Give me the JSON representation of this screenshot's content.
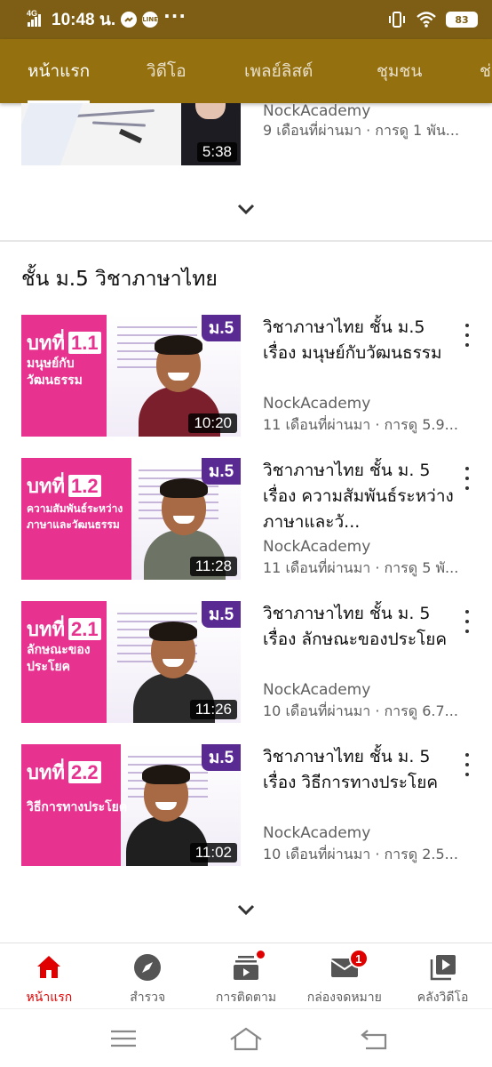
{
  "status_bar": {
    "network": "4G",
    "time": "10:48 น.",
    "battery": "83",
    "icons": [
      "signal-icon",
      "messenger-icon",
      "line-icon",
      "more-dots-icon",
      "vibrate-icon",
      "wifi-icon",
      "battery-icon"
    ]
  },
  "tabs": [
    {
      "label": "หน้าแรก",
      "active": true
    },
    {
      "label": "วิดีโอ",
      "active": false
    },
    {
      "label": "เพลย์ลิสต์",
      "active": false
    },
    {
      "label": "ชุมชน",
      "active": false
    },
    {
      "label": "ช่",
      "active": false
    }
  ],
  "top_video": {
    "channel": "NockAcademy",
    "stats": "9 เดือนที่ผ่านมา · การดู 1 พัน...",
    "duration": "5:38"
  },
  "section": {
    "title": "ชั้น ม.5 วิชาภาษาไทย",
    "videos": [
      {
        "title": "วิชาภาษาไทย ชั้น ม.5 เรื่อง มนุษย์กับวัฒนธรรม",
        "channel": "NockAcademy",
        "stats": "11 เดือนที่ผ่านมา · การดู 5.9...",
        "duration": "10:20",
        "thumb_chapter": "บทที่",
        "thumb_number": "1.1",
        "thumb_subtitle": "มนุษย์กับ วัฒนธรรม",
        "thumb_grade": "ม.5",
        "shirt_color": "#7a1f2b"
      },
      {
        "title": "วิชาภาษาไทย ชั้น ม. 5 เรื่อง ความสัมพันธ์ระหว่างภาษาและวั...",
        "channel": "NockAcademy",
        "stats": "11 เดือนที่ผ่านมา · การดู 5 พั...",
        "duration": "11:28",
        "thumb_chapter": "บทที่",
        "thumb_number": "1.2",
        "thumb_subtitle": "ความสัมพันธ์ระหว่าง ภาษาและวัฒนธรรม",
        "thumb_grade": "ม.5",
        "shirt_color": "#6d7466"
      },
      {
        "title": "วิชาภาษาไทย ชั้น ม. 5 เรื่อง ลักษณะของประโยค",
        "channel": "NockAcademy",
        "stats": "10 เดือนที่ผ่านมา · การดู 6.7...",
        "duration": "11:26",
        "thumb_chapter": "บทที่",
        "thumb_number": "2.1",
        "thumb_subtitle": "ลักษณะของ ประโยค",
        "thumb_grade": "ม.5",
        "shirt_color": "#2b2b2b"
      },
      {
        "title": "วิชาภาษาไทย ชั้น ม. 5 เรื่อง วิธีการทางประโยค",
        "channel": "NockAcademy",
        "stats": "10 เดือนที่ผ่านมา · การดู 2.5...",
        "duration": "11:02",
        "thumb_chapter": "บทที่",
        "thumb_number": "2.2",
        "thumb_subtitle": "วิธีการทางประโยค",
        "thumb_grade": "ม.5",
        "shirt_color": "#1f1f1f"
      }
    ]
  },
  "bottom_nav": [
    {
      "label": "หน้าแรก",
      "icon": "home-icon",
      "active": true
    },
    {
      "label": "สำรวจ",
      "icon": "explore-icon",
      "active": false
    },
    {
      "label": "การติดตาม",
      "icon": "subscriptions-icon",
      "active": false,
      "dot": true
    },
    {
      "label": "กล่องจดหมาย",
      "icon": "inbox-icon",
      "active": false,
      "badge": "1"
    },
    {
      "label": "คลังวิดีโอ",
      "icon": "library-icon",
      "active": false
    }
  ],
  "colors": {
    "status_bar": "#7d5e14",
    "tab_bar": "#95700f",
    "accent_red": "#e00000",
    "thumb_pink": "#e7338f",
    "thumb_purple": "#5a2a93"
  }
}
